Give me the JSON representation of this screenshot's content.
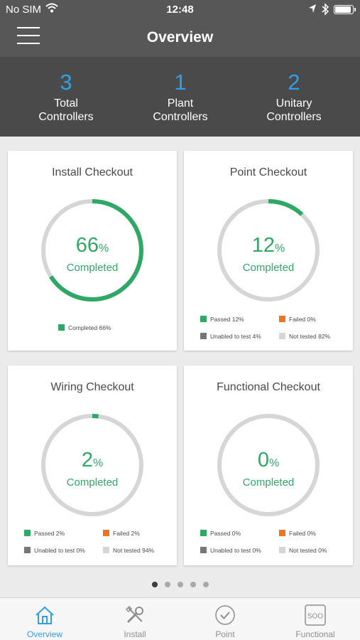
{
  "status_bar": {
    "carrier": "No SIM",
    "time": "12:48"
  },
  "nav": {
    "title": "Overview"
  },
  "summary": [
    {
      "count": "3",
      "line1": "Total",
      "line2": "Controllers"
    },
    {
      "count": "1",
      "line1": "Plant",
      "line2": "Controllers"
    },
    {
      "count": "2",
      "line1": "Unitary",
      "line2": "Controllers"
    }
  ],
  "colors": {
    "accent": "#2f9fe8",
    "completed": "#2fa866",
    "failed": "#ee7623",
    "unable": "#777777",
    "not_tested": "#d6d6d6"
  },
  "cards": [
    {
      "title": "Install Checkout",
      "percent": 66,
      "percent_text": "66",
      "completed_label": "Completed",
      "legend": [
        {
          "label": "Completed 66%",
          "color": "#2fa866"
        }
      ]
    },
    {
      "title": "Point Checkout",
      "percent": 12,
      "percent_text": "12",
      "completed_label": "Completed",
      "legend": [
        {
          "label": "Passed 12%",
          "color": "#2fa866"
        },
        {
          "label": "Failed 0%",
          "color": "#ee7623"
        },
        {
          "label": "Unabled to test 4%",
          "color": "#777777"
        },
        {
          "label": "Not tested 82%",
          "color": "#d6d6d6"
        }
      ]
    },
    {
      "title": "Wiring Checkout",
      "percent": 2,
      "percent_text": "2",
      "completed_label": "Completed",
      "legend": [
        {
          "label": "Passed 2%",
          "color": "#2fa866"
        },
        {
          "label": "Failed 2%",
          "color": "#ee7623"
        },
        {
          "label": "Unabled to test 0%",
          "color": "#777777"
        },
        {
          "label": "Not tested 94%",
          "color": "#d6d6d6"
        }
      ]
    },
    {
      "title": "Functional Checkout",
      "percent": 0,
      "percent_text": "0",
      "completed_label": "Completed",
      "legend": [
        {
          "label": "Passed 0%",
          "color": "#2fa866"
        },
        {
          "label": "Failed 0%",
          "color": "#ee7623"
        },
        {
          "label": "Unabled to test 0%",
          "color": "#777777"
        },
        {
          "label": "Not tested 0%",
          "color": "#d6d6d6"
        }
      ]
    }
  ],
  "pager": {
    "count": 5,
    "active": 0
  },
  "tabs": [
    {
      "label": "Overview",
      "icon": "home-icon"
    },
    {
      "label": "Install",
      "icon": "tools-icon"
    },
    {
      "label": "Point",
      "icon": "check-circle-icon"
    },
    {
      "label": "Functional",
      "icon": "soo-icon",
      "icon_text": "SOO"
    }
  ]
}
